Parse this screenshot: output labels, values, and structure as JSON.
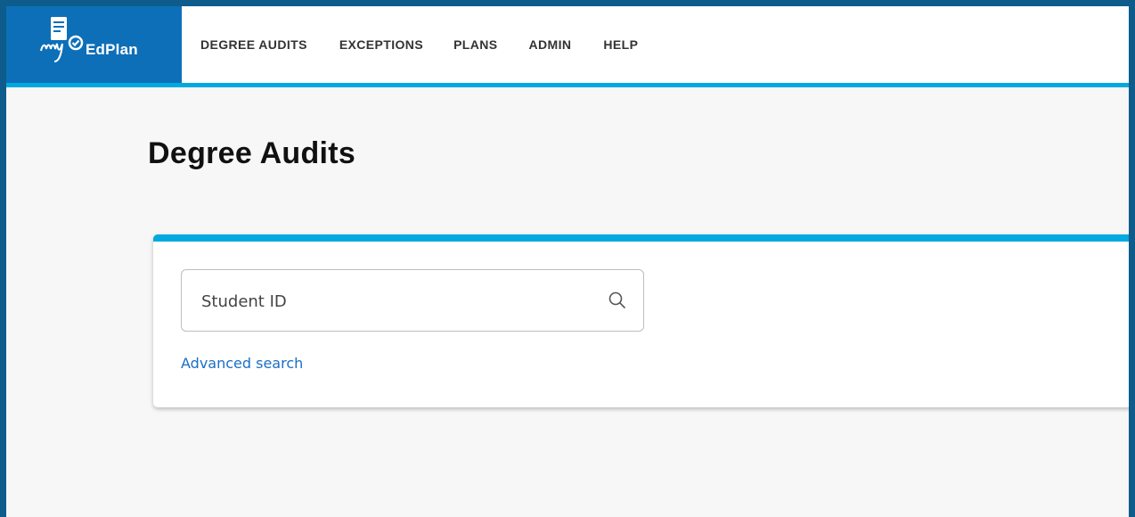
{
  "brand": {
    "logo_text": "EdPlan",
    "logo_icon": "my-edplan-document-check-icon",
    "brand_color": "#0d6fb8",
    "accent_color": "#00a9e0",
    "frame_color": "#0d5c8c"
  },
  "nav": {
    "items": [
      {
        "label": "DEGREE AUDITS"
      },
      {
        "label": "EXCEPTIONS"
      },
      {
        "label": "PLANS"
      },
      {
        "label": "ADMIN"
      },
      {
        "label": "HELP"
      }
    ]
  },
  "page": {
    "title": "Degree Audits"
  },
  "search": {
    "placeholder": "Student ID",
    "value": "",
    "icon": "search-icon",
    "advanced_link": "Advanced search",
    "link_color": "#1a6fc4"
  }
}
